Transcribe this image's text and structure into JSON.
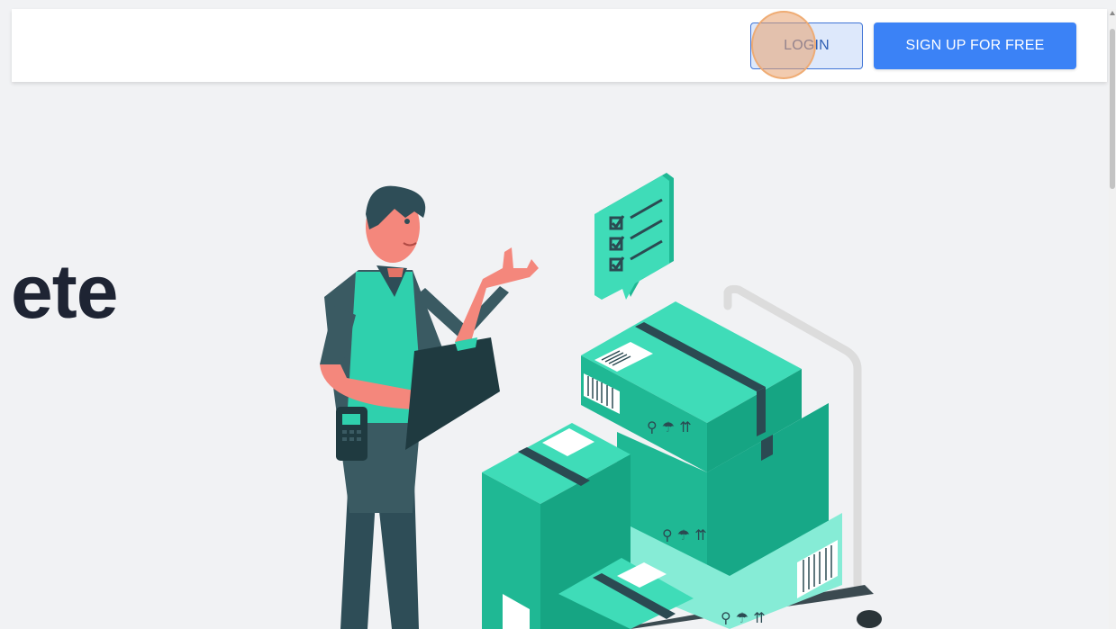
{
  "header": {
    "login_label": "LOGIN",
    "signup_label": "SIGN UP FOR FREE"
  },
  "hero": {
    "headline_fragment": "ete"
  },
  "colors": {
    "primary": "#3b82f6",
    "login_bg": "#dde8fb",
    "teal": "#2fd0ad",
    "dark_teal": "#2e4d57",
    "heading": "#1e2433"
  },
  "icons": [
    "checklist-icon",
    "barcode-icon",
    "fragile-symbol-icon"
  ]
}
